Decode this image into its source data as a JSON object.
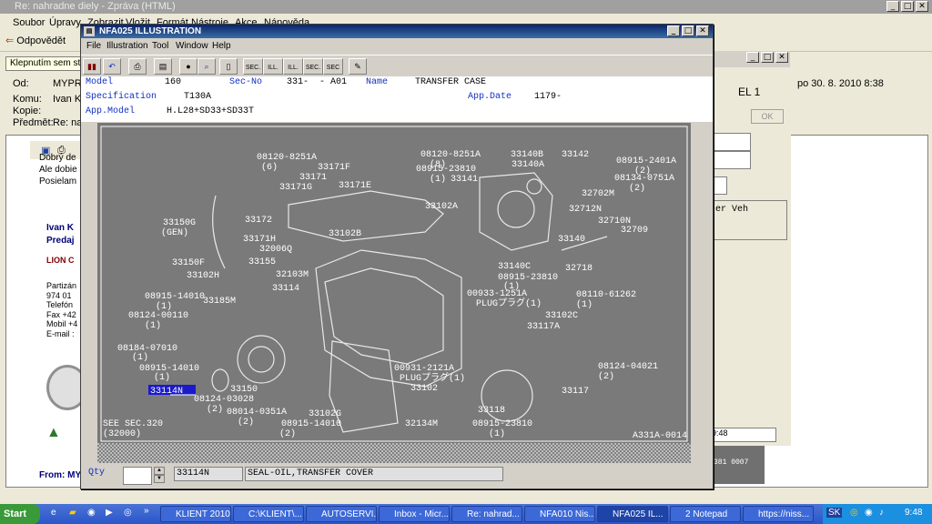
{
  "mail_window": {
    "title": "Re: nahradne diely - Zpráva (HTML)",
    "menu": [
      "Soubor",
      "Úpravy",
      "Zobrazit",
      "Vložit",
      "Formát",
      "Nástroje",
      "Akce",
      "Nápověda"
    ],
    "toolbar_reply": "Odpovědět",
    "info_bar": "Klepnutím sem stáh",
    "headers": {
      "from_label": "Od:",
      "from_value": "MYPRIN",
      "to_label": "Komu:",
      "to_value": "Ivan Ko",
      "cc_label": "Kopie:",
      "cc_value": "",
      "subject_label": "Předmět:",
      "subject_value": "Re: nah"
    },
    "sent_text": "po 30. 8. 2010 8:38",
    "body_lines": [
      "Dobrý de",
      "Ale dobie",
      "Posielam"
    ],
    "signature": {
      "name": "Ivan K",
      "role": "Predaj",
      "company": "LION C",
      "addr1": "Partizán",
      "addr2": "974 01",
      "phone": "Telefón",
      "fax": "Fax +42",
      "mobile": "Mobil +4",
      "email": "E-mail :"
    },
    "footer_from": "From: MY"
  },
  "bg_window": {
    "label_el": "EL 1",
    "ok_label": "OK",
    "tab_label": "er Veh",
    "time": "9:48",
    "code": "381 0007"
  },
  "illustration_window": {
    "title": "NFA025 ILLUSTRATION",
    "menu": [
      "File",
      "Illustration",
      "Tool",
      "Window",
      "Help"
    ],
    "toolbar_labels": [
      "SEC.",
      "ILL.",
      "ILL.",
      "SEC.",
      "SEC"
    ],
    "info": {
      "model_label": "Model",
      "model_value": "160",
      "secno_label": "Sec-No",
      "secno_value": "331-  - A01",
      "name_label": "Name",
      "name_value": "TRANSFER CASE",
      "spec_label": "Specification",
      "spec_value": "T130A",
      "appdate_label": "App.Date",
      "appdate_value": "1179-",
      "appmodel_label": "App.Model",
      "appmodel_value": "H.L28+SD33+SD33T"
    },
    "selected_part": "33114N",
    "drawing_labels": [
      "08120-8251A",
      "(6)",
      "33171F",
      "33171",
      "33171G",
      "33171E",
      "08120-8251A",
      "(8)",
      "08915-23810",
      "(1)",
      "33140B",
      "33140A",
      "33142",
      "08915-2401A",
      "(2)",
      "08134-0751A",
      "(2)",
      "32702M",
      "33141",
      "33102A",
      "32712N",
      "32710N",
      "32709",
      "33150G",
      "(GEN)",
      "33172",
      "33171H",
      "32006Q",
      "33102B",
      "33140",
      "33150F",
      "33155",
      "32103M",
      "33140C",
      "32718",
      "33102H",
      "08915-23810",
      "(1)",
      "08915-14010",
      "(1)",
      "33185M",
      "33114",
      "00933-1251A",
      "PLUGプラグ(1)",
      "08110-61262",
      "(1)",
      "08124-00110",
      "(1)",
      "33102C",
      "33117A",
      "08184-07010",
      "(1)",
      "08915-14010",
      "(1)",
      "08124-04021",
      "(2)",
      "33150",
      "00931-2121A",
      "PLUGプラグ(1)",
      "08124-03028",
      "(2)",
      "33102",
      "33117",
      "08014-0351A",
      "(2)",
      "33102G",
      "33118",
      "SEE SEC.320",
      "(32000)",
      "08915-14010",
      "(2)",
      "32134M",
      "08915-23810",
      "(1)",
      "A331A-0014"
    ],
    "qty_label": "Qty",
    "qty_value": "",
    "part_number": "33114N",
    "part_name": "SEAL-OIL,TRANSFER COVER"
  },
  "taskbar": {
    "start": "Start",
    "tasks": [
      "KLIENT 2010",
      "C:\\KLIENT\\...",
      "AUTOSERVI...",
      "Inbox - Micr...",
      "Re: nahrad...",
      "NFA010 Nis...",
      "NFA025 IL...",
      "2 Notepad",
      "https://niss..."
    ],
    "lang": "SK",
    "clock": "9:48"
  }
}
